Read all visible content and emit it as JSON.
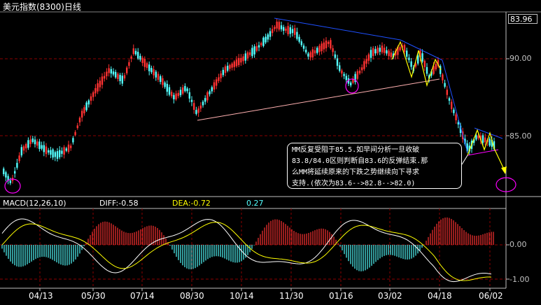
{
  "window": {
    "title": "美元指数(8300)日线",
    "last_price": "83.96"
  },
  "annotation": {
    "lines": [
      "MM反复受阻于85.5.如早间分析一旦收破",
      "83.8/84.0区则判断自83.6的反弹结束.那",
      "么MM将延续原来的下跌之势继续向下寻求",
      "支持.(依次为83.6-->82.8-->82.0)"
    ]
  },
  "macd": {
    "label": "MACD(12,26,10)",
    "diff": "DIFF:-0.58",
    "dea": "DEA:-0.72",
    "macd_value": "0.27"
  },
  "price_axis": [
    "90.00",
    "85.00"
  ],
  "macd_axis": [
    "0.00",
    "-1.00"
  ],
  "date_axis": [
    "04/13",
    "05/30",
    "07/14",
    "08/30",
    "10/14",
    "11/30",
    "01/16",
    "03/02",
    "04/18",
    "06/02"
  ],
  "colors": {
    "up": "#ff3232",
    "down": "#54ffff",
    "grid": "#8b0000",
    "trend_blue": "#1e50ff",
    "trend_pink": "#ffb0b0",
    "pattern_yellow": "#ffff00",
    "circle_magenta": "#ff00ff",
    "diff_line": "#ffffff",
    "dea_line": "#ffff00"
  }
}
